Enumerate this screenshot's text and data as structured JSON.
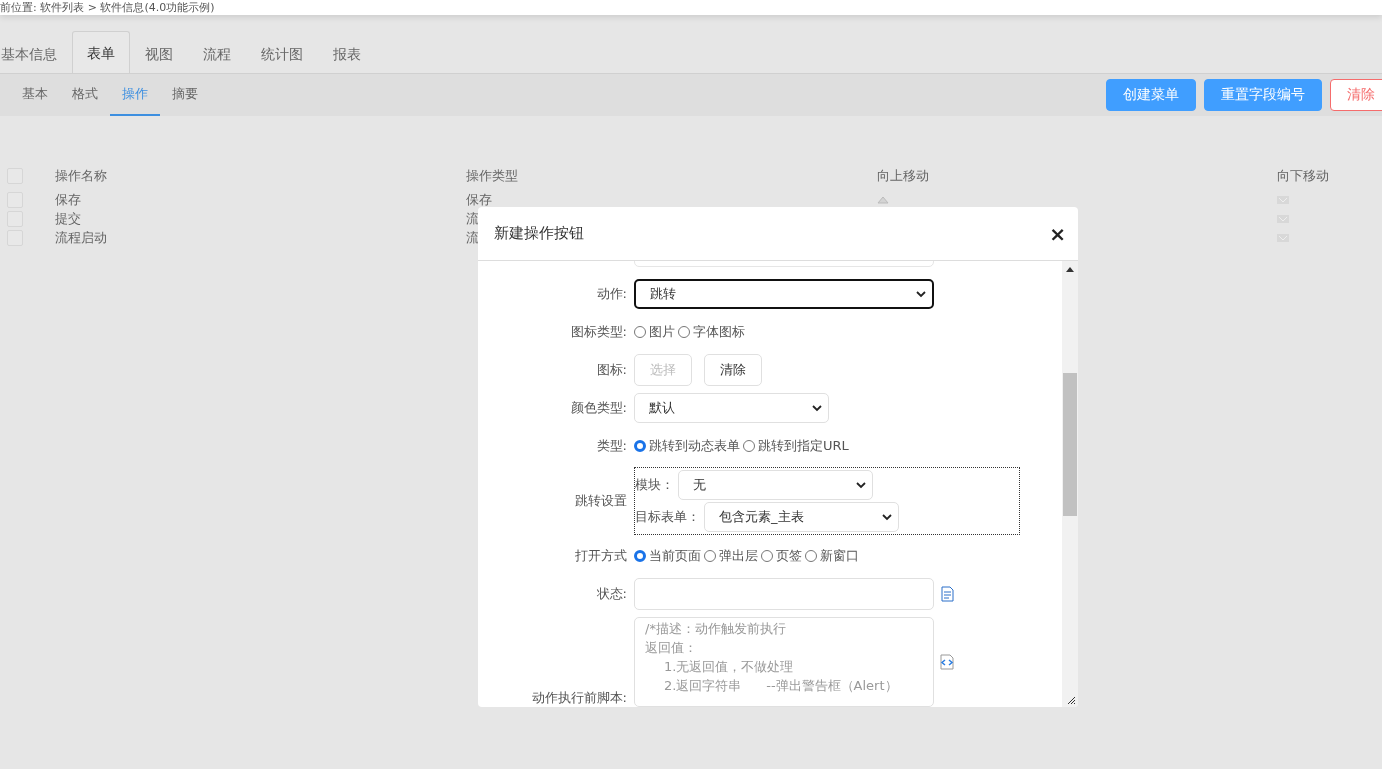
{
  "breadcrumb": "前位置: 软件列表 > 软件信息(4.0功能示例)",
  "tabs": [
    {
      "label": "基本信息",
      "selected": false
    },
    {
      "label": "表单",
      "selected": true
    },
    {
      "label": "视图",
      "selected": false
    },
    {
      "label": "流程",
      "selected": false
    },
    {
      "label": "统计图",
      "selected": false
    },
    {
      "label": "报表",
      "selected": false
    }
  ],
  "subtabs": [
    {
      "label": "基本",
      "selected": false
    },
    {
      "label": "格式",
      "selected": false
    },
    {
      "label": "操作",
      "selected": true
    },
    {
      "label": "摘要",
      "selected": false
    }
  ],
  "toolbar_buttons": [
    {
      "label": "创建菜单",
      "kind": "primary"
    },
    {
      "label": "重置字段编号",
      "kind": "primary"
    },
    {
      "label": "清除",
      "kind": "danger"
    }
  ],
  "table": {
    "columns": [
      "操作名称",
      "操作类型",
      "向上移动",
      "向下移动"
    ],
    "all_checked": false,
    "rows": [
      {
        "name": "保存",
        "type": "保存",
        "checked": false,
        "up": true
      },
      {
        "name": "提交",
        "type": "流",
        "checked": false
      },
      {
        "name": "流程启动",
        "type": "流",
        "checked": false
      }
    ]
  },
  "dialog": {
    "title": "新建操作按钮",
    "close": "×",
    "fields": [
      {
        "kind": "select",
        "label": "动作:",
        "value": "跳转",
        "focused": true
      },
      {
        "kind": "radio",
        "label": "图标类型:",
        "options": [
          {
            "label": "图片",
            "selected": false
          },
          {
            "label": "字体图标",
            "selected": false
          }
        ]
      },
      {
        "kind": "buttons",
        "label": "图标:",
        "buttons": [
          {
            "label": "选择",
            "disabled": true
          },
          {
            "label": "清除",
            "disabled": false
          }
        ]
      },
      {
        "kind": "select",
        "label": "颜色类型:",
        "value": "默认",
        "focused": false
      },
      {
        "kind": "radio",
        "label": "类型:",
        "options": [
          {
            "label": "跳转到动态表单",
            "selected": true
          },
          {
            "label": "跳转到指定URL",
            "selected": false
          }
        ]
      },
      {
        "kind": "group",
        "label": "跳转设置",
        "items": [
          {
            "label": "模块：",
            "value": "无"
          },
          {
            "label": "目标表单：",
            "value": "包含元素_主表"
          }
        ]
      },
      {
        "kind": "radio",
        "label": "打开方式",
        "options": [
          {
            "label": "当前页面",
            "selected": true
          },
          {
            "label": "弹出层",
            "selected": false
          },
          {
            "label": "页签",
            "selected": false
          },
          {
            "label": "新窗口",
            "selected": false
          }
        ]
      },
      {
        "kind": "text",
        "label": "状态:"
      },
      {
        "kind": "script",
        "label": "动作执行前脚本:",
        "lines": [
          {
            "text": "/*描述：动作触发前执行",
            "indent": false
          },
          {
            "text": "返回值：",
            "indent": false
          },
          {
            "text": "1.无返回值，不做处理",
            "indent": true
          },
          {
            "text": "2.返回字符串      --弹出警告框（Alert）",
            "indent": true
          }
        ]
      }
    ]
  }
}
